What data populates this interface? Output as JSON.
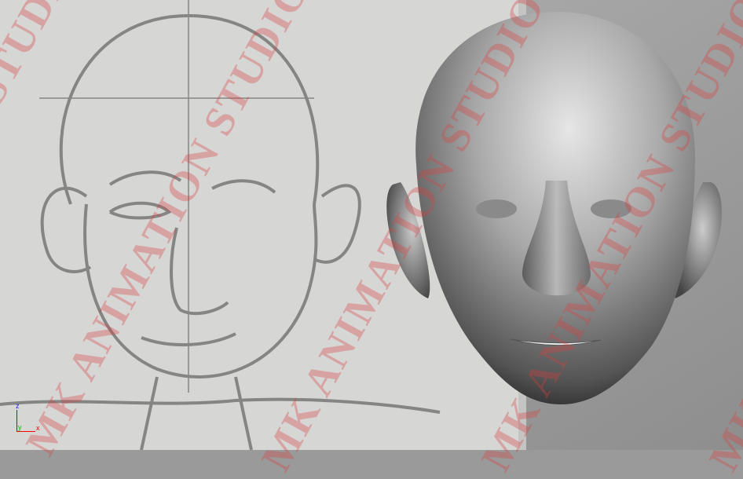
{
  "viewport": {
    "watermark_text": "MK ANIMATION STUDIO",
    "axis_labels": {
      "x": "x",
      "y": "y",
      "z": "z"
    },
    "colors": {
      "watermark": "#dc3c3c",
      "x_axis": "#ff0000",
      "y_axis": "#00c000",
      "z_axis": "#2020ff"
    }
  }
}
